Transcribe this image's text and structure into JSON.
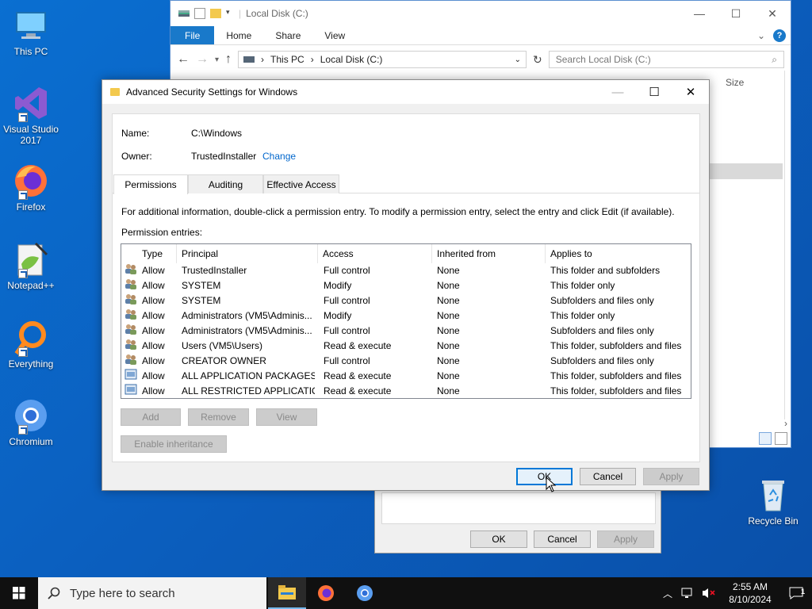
{
  "desktop": {
    "icons": [
      {
        "label": "This PC",
        "icon": "this-pc-icon"
      },
      {
        "label": "Visual Studio 2017",
        "icon": "visual-studio-icon"
      },
      {
        "label": "Firefox",
        "icon": "firefox-icon"
      },
      {
        "label": "Notepad++",
        "icon": "notepadpp-icon"
      },
      {
        "label": "Everything",
        "icon": "everything-icon"
      },
      {
        "label": "Chromium",
        "icon": "chromium-icon"
      },
      {
        "label": "Recycle Bin",
        "icon": "recycle-bin-icon"
      }
    ]
  },
  "explorer": {
    "title": "Local Disk (C:)",
    "ribbon_tabs": [
      "File",
      "Home",
      "Share",
      "View"
    ],
    "address": {
      "crumb1": "This PC",
      "crumb2": "Local Disk (C:)"
    },
    "search_placeholder": "Search Local Disk (C:)",
    "column_size": "Size"
  },
  "dialog": {
    "title": "Advanced Security Settings for Windows",
    "name_label": "Name:",
    "name_value": "C:\\Windows",
    "owner_label": "Owner:",
    "owner_value": "TrustedInstaller",
    "change_link": "Change",
    "tabs": [
      "Permissions",
      "Auditing",
      "Effective Access"
    ],
    "info_text": "For additional information, double-click a permission entry. To modify a permission entry, select the entry and click Edit (if available).",
    "entries_label": "Permission entries:",
    "columns": [
      "Type",
      "Principal",
      "Access",
      "Inherited from",
      "Applies to"
    ],
    "rows": [
      {
        "type": "Allow",
        "principal": "TrustedInstaller",
        "access": "Full control",
        "inherited": "None",
        "applies": "This folder and subfolders",
        "icon": "users-icon"
      },
      {
        "type": "Allow",
        "principal": "SYSTEM",
        "access": "Modify",
        "inherited": "None",
        "applies": "This folder only",
        "icon": "users-icon"
      },
      {
        "type": "Allow",
        "principal": "SYSTEM",
        "access": "Full control",
        "inherited": "None",
        "applies": "Subfolders and files only",
        "icon": "users-icon"
      },
      {
        "type": "Allow",
        "principal": "Administrators (VM5\\Adminis...",
        "access": "Modify",
        "inherited": "None",
        "applies": "This folder only",
        "icon": "users-icon"
      },
      {
        "type": "Allow",
        "principal": "Administrators (VM5\\Adminis...",
        "access": "Full control",
        "inherited": "None",
        "applies": "Subfolders and files only",
        "icon": "users-icon"
      },
      {
        "type": "Allow",
        "principal": "Users (VM5\\Users)",
        "access": "Read & execute",
        "inherited": "None",
        "applies": "This folder, subfolders and files",
        "icon": "users-icon"
      },
      {
        "type": "Allow",
        "principal": "CREATOR OWNER",
        "access": "Full control",
        "inherited": "None",
        "applies": "Subfolders and files only",
        "icon": "users-icon"
      },
      {
        "type": "Allow",
        "principal": "ALL APPLICATION PACKAGES",
        "access": "Read & execute",
        "inherited": "None",
        "applies": "This folder, subfolders and files",
        "icon": "package-icon"
      },
      {
        "type": "Allow",
        "principal": "ALL RESTRICTED APPLICATIO...",
        "access": "Read & execute",
        "inherited": "None",
        "applies": "This folder, subfolders and files",
        "icon": "package-icon"
      }
    ],
    "buttons": {
      "add": "Add",
      "remove": "Remove",
      "view": "View",
      "enable_inheritance": "Enable inheritance",
      "ok": "OK",
      "cancel": "Cancel",
      "apply": "Apply"
    }
  },
  "properties": {
    "buttons": {
      "ok": "OK",
      "cancel": "Cancel",
      "apply": "Apply"
    }
  },
  "taskbar": {
    "search_placeholder": "Type here to search",
    "time": "2:55 AM",
    "date": "8/10/2024",
    "notification_count": "1"
  },
  "colors": {
    "accent": "#0078d7",
    "link": "#0066cc",
    "desktop": "#0b5fbf"
  }
}
